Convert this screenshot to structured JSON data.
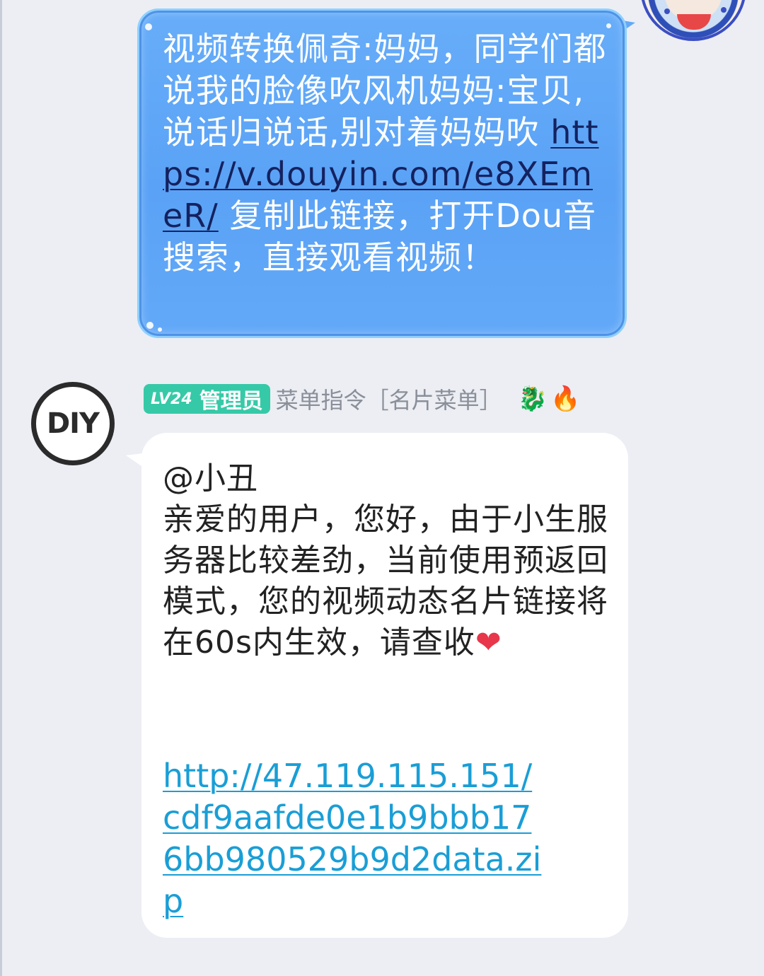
{
  "sent_message": {
    "text": "视频转换佩奇:妈妈，同学们都说我的脸像吹风机妈妈:宝贝,说话归说话,别对着妈妈吹 ",
    "link": "https://v.douyin.com/e8XEmeR/",
    "suffix": " 复制此链接，打开Dou音搜索，直接观看视频！"
  },
  "received_message": {
    "sender": {
      "avatar_text": "DIY",
      "level": "LV24",
      "role": "管理员",
      "name": "菜单指令［名片菜单］"
    },
    "mention": "@小丑",
    "body": "亲爱的用户，您好，由于小生服务器比较差劲，当前使用预返回模式，您的视频动态名片链接将在60s内生效，请查收",
    "link": "http://47.119.115.151/cdf9aafde0e1b9bbb176bb980529b9d2data.zip"
  },
  "colors": {
    "sent_bubble": "#5aa2f6",
    "link_dark": "#14225f",
    "link_blue": "#1a9ed6",
    "badge": "#36c9a8",
    "background": "#eceef4"
  },
  "icons": [
    "dragon-emoji-icon",
    "fire-emoji-icon",
    "heart-emoji-icon"
  ]
}
